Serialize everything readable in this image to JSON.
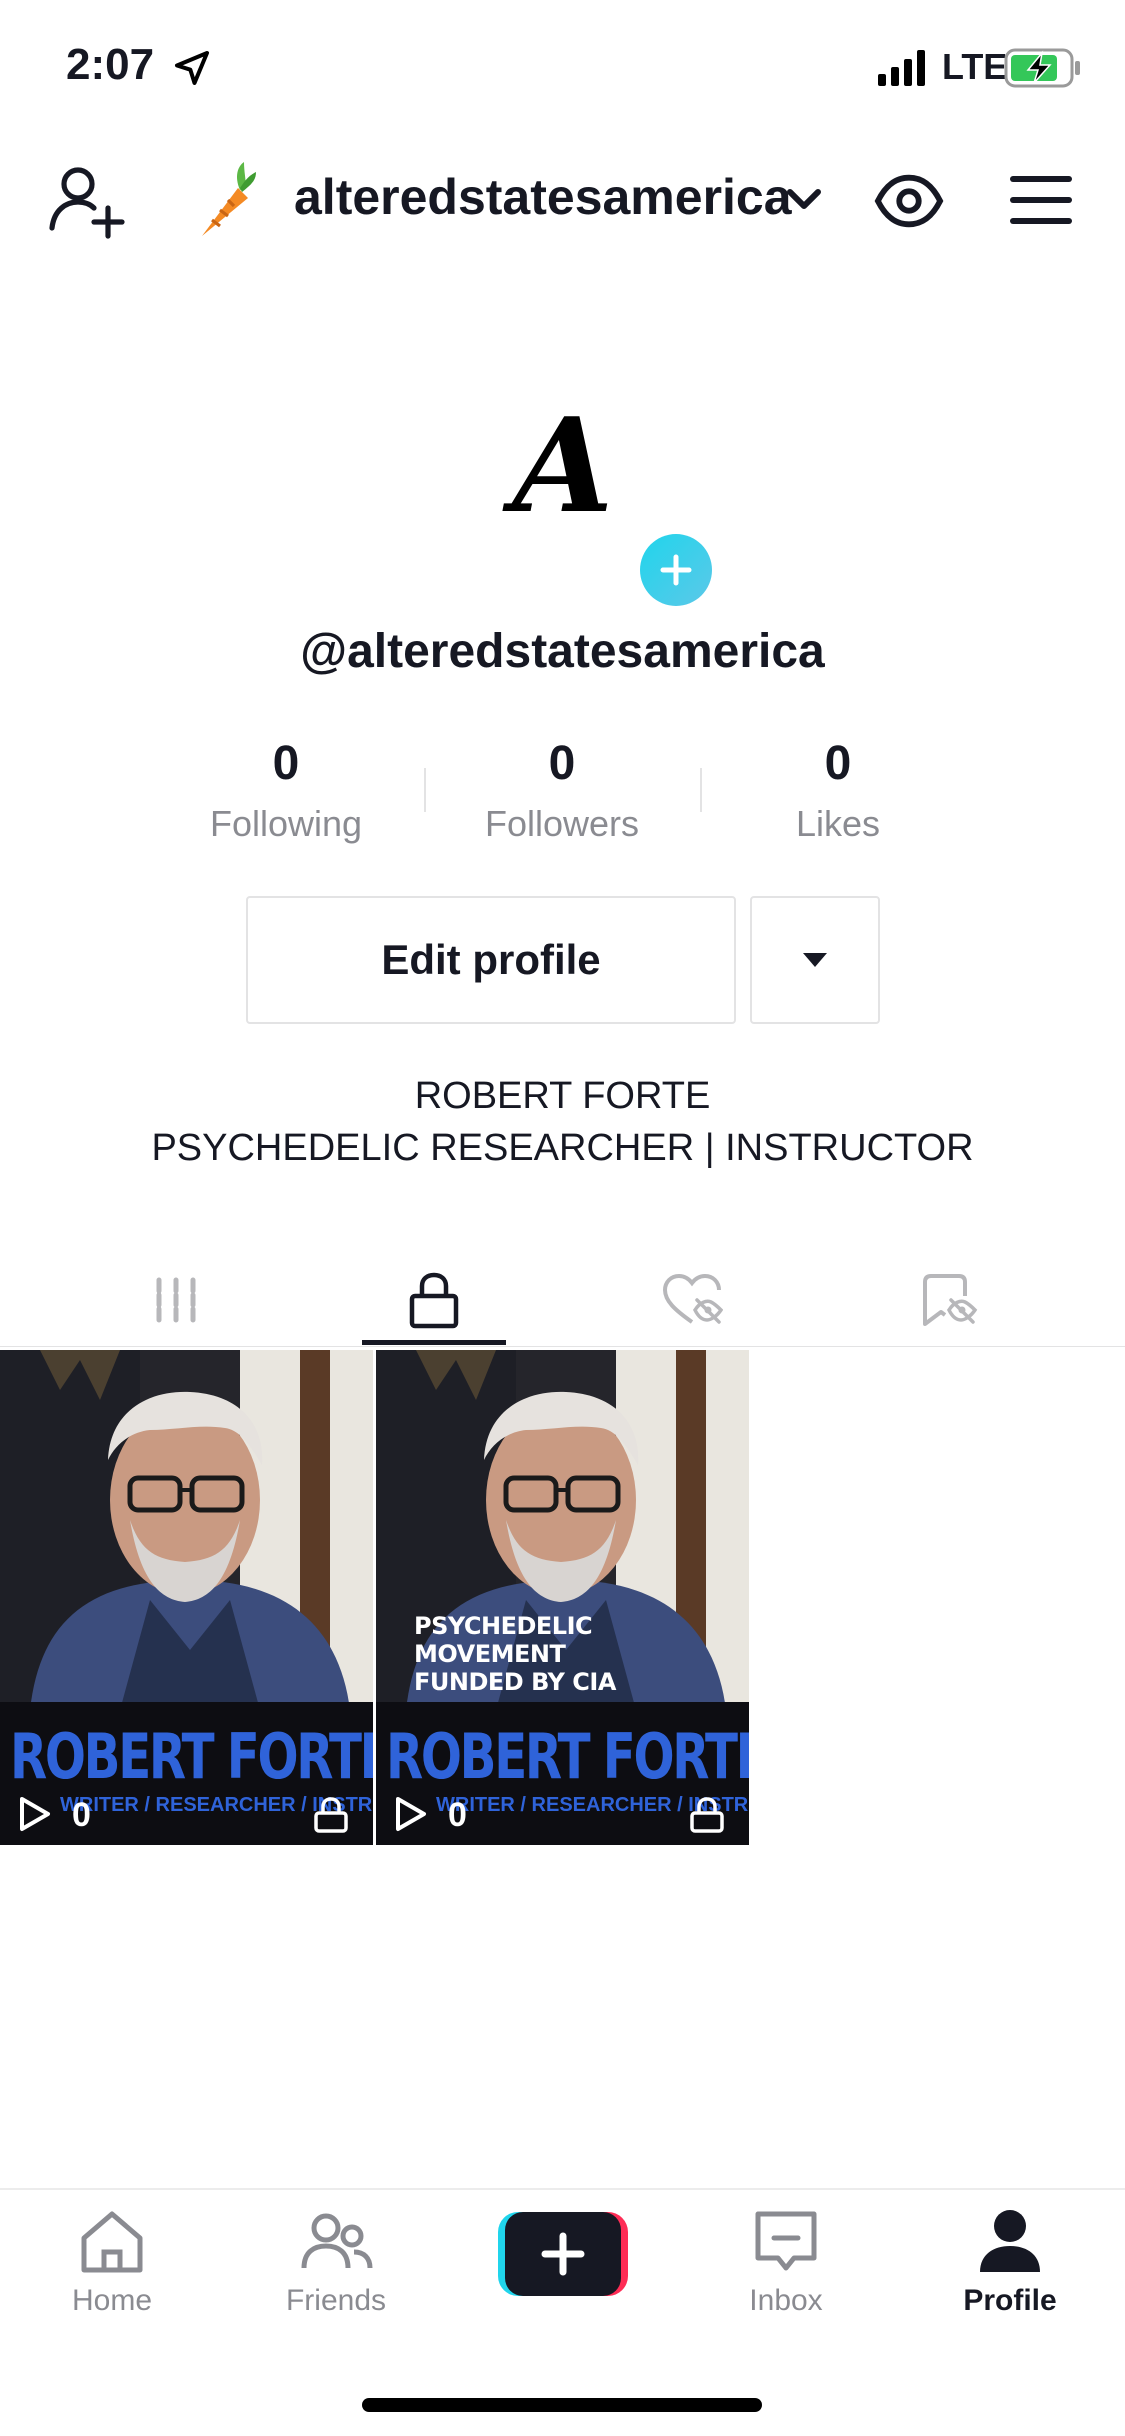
{
  "status_bar": {
    "time": "2:07",
    "network": "LTE"
  },
  "header": {
    "username": "alteredstatesamerica",
    "emoji_icon": "carrot-icon"
  },
  "profile": {
    "avatar_letter": "A",
    "handle": "@alteredstatesamerica",
    "stats": [
      {
        "value": "0",
        "label": "Following"
      },
      {
        "value": "0",
        "label": "Followers"
      },
      {
        "value": "0",
        "label": "Likes"
      }
    ],
    "edit_profile_label": "Edit profile",
    "bio_lines": [
      "ROBERT FORTE",
      "PSYCHEDELIC RESEARCHER | INSTRUCTOR"
    ]
  },
  "tabs": [
    {
      "name": "videos-grid-icon",
      "active": false
    },
    {
      "name": "private-lock-icon",
      "active": true
    },
    {
      "name": "liked-hidden-icon",
      "active": false
    },
    {
      "name": "saved-hidden-icon",
      "active": false
    }
  ],
  "videos": [
    {
      "caption": "",
      "title": "ROBERT FORTE",
      "subtitle": "WRITER / RESEARCHER / INSTRUCTOR",
      "views": "0"
    },
    {
      "caption": "PSYCHEDELIC MOVEMENT FUNDED BY CIA",
      "title": "ROBERT FORTE",
      "subtitle": "WRITER / RESEARCHER / INSTRUCTOR",
      "views": "0"
    }
  ],
  "bottom_nav": {
    "home": "Home",
    "friends": "Friends",
    "inbox": "Inbox",
    "profile": "Profile"
  },
  "colors": {
    "accent_cyan": "#20d5ec",
    "accent_pink": "#fe2c55",
    "text_primary": "#161823",
    "text_secondary": "#8a8b91"
  }
}
